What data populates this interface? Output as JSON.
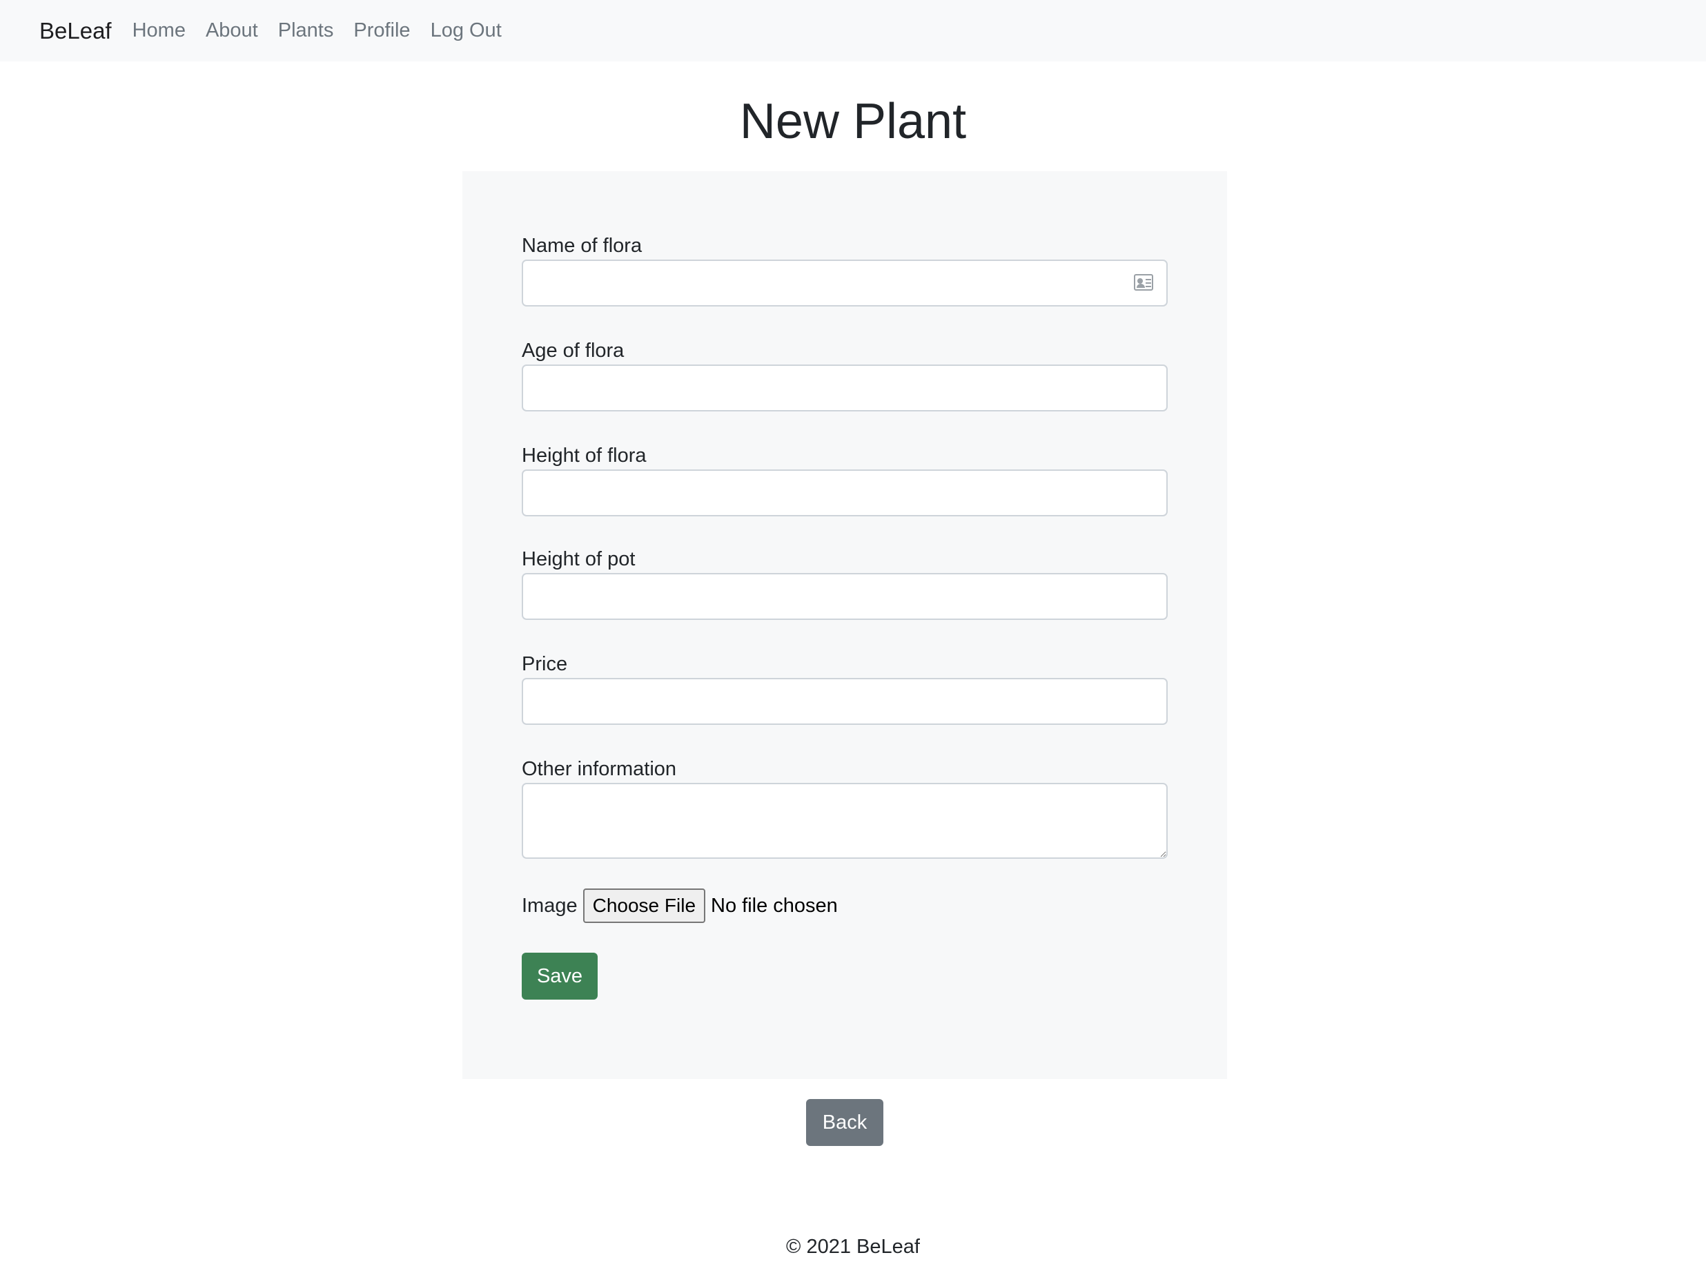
{
  "navbar": {
    "brand": "BeLeaf",
    "links": [
      "Home",
      "About",
      "Plants",
      "Profile",
      "Log Out"
    ]
  },
  "page": {
    "title": "New Plant"
  },
  "form": {
    "fields": [
      {
        "label": "Name of flora",
        "value": ""
      },
      {
        "label": "Age of flora",
        "value": ""
      },
      {
        "label": "Height of flora",
        "value": ""
      },
      {
        "label": "Height of pot",
        "value": ""
      },
      {
        "label": "Price",
        "value": ""
      },
      {
        "label": "Other information",
        "value": ""
      }
    ],
    "image_label": "Image",
    "file_button": "Choose File",
    "file_status": "No file chosen",
    "save_label": "Save"
  },
  "back_label": "Back",
  "footer": {
    "text": "© 2021 BeLeaf"
  },
  "colors": {
    "save": "#3d8254",
    "back": "#6c757d",
    "navbar_bg": "#f8f9fa",
    "card_bg": "#f7f8f9"
  }
}
